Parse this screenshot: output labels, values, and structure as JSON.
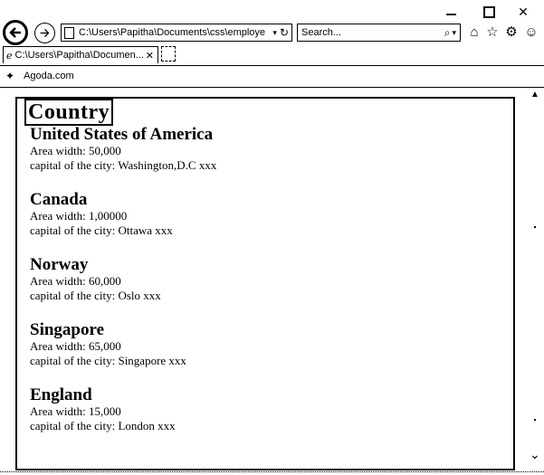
{
  "window": {
    "minimize_glyph": "",
    "close_glyph": "✕"
  },
  "toolbar": {
    "address_url": "C:\\Users\\Papitha\\Documents\\css\\employe",
    "address_dropdown": "▾",
    "refresh": "↻",
    "search_placeholder": "Search...",
    "search_glyph": "⌕",
    "search_dropdown": "▾",
    "home_glyph": "⌂",
    "favorites_glyph": "☆",
    "settings_glyph": "⚙",
    "feedback_glyph": "☺"
  },
  "tab": {
    "title": "C:\\Users\\Papitha\\Documen...",
    "close_glyph": "✕"
  },
  "favorites_bar": {
    "suggested_glyph": "✦",
    "agoda_label": "Agoda.com"
  },
  "page": {
    "heading": "Country",
    "countries": [
      {
        "name": "United States of America",
        "area": "Area width: 50,000",
        "capital": "capital of the city: Washington,D.C xxx"
      },
      {
        "name": "Canada",
        "area": "Area width: 1,00000",
        "capital": "capital of the city: Ottawa xxx"
      },
      {
        "name": "Norway",
        "area": "Area width: 60,000",
        "capital": "capital of the city: Oslo xxx"
      },
      {
        "name": "Singapore",
        "area": "Area width: 65,000",
        "capital": "capital of the city: Singapore xxx"
      },
      {
        "name": "England",
        "area": "Area width: 15,000",
        "capital": "capital of the city: London xxx"
      }
    ]
  }
}
